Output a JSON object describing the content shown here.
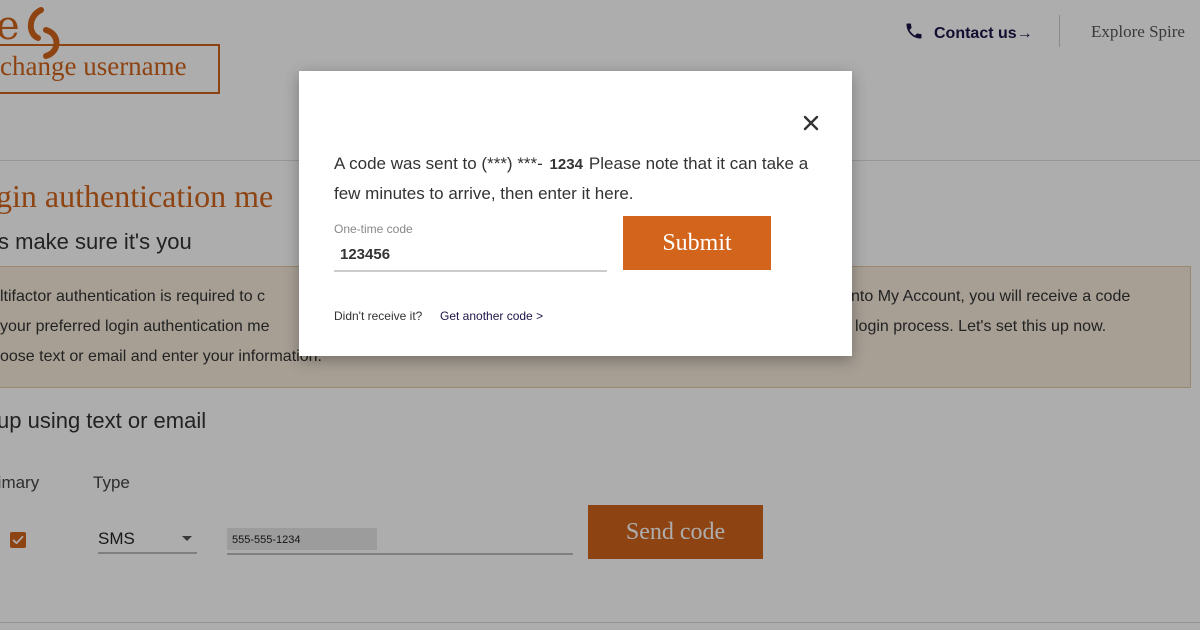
{
  "header": {
    "logo_text": "e",
    "contact_label": "Contact us",
    "contact_arrow": "→",
    "explore_label": "Explore Spire"
  },
  "page": {
    "change_username_label": "change username",
    "section_title": "gin authentication me",
    "section_subtitle": "s make sure it's you",
    "info_lines": [
      "ltifactor authentication is required to c",
      " your preferred login authentication me",
      "oose text or email and enter your information."
    ],
    "info_lines_right": [
      "nto My Account, you will receive a code",
      "login process. Let's set this up now."
    ],
    "setup_heading": "up using text or email",
    "column_primary": "rimary",
    "column_type": "Type",
    "type_selected": "SMS",
    "phone_value": "555-555-1234",
    "send_code_label": "Send code"
  },
  "modal": {
    "message_before": "A code was sent to (***) ***- ",
    "masked_digits": "1234",
    "message_after": "Please note that it can take a few minutes to arrive, then enter it here.",
    "otp_label": "One-time code",
    "otp_value": "123456",
    "submit_label": "Submit",
    "resend_text": "Didn't receive it?",
    "resend_link": "Get another code >"
  },
  "colors": {
    "brand_orange": "#d2651b",
    "brand_navy": "#1f1448",
    "info_box_bg": "#f6ebda"
  },
  "icons": {
    "logo": "spire-logo-mark",
    "phone": "phone-icon",
    "close": "close-icon",
    "check": "check-icon",
    "dropdown": "chevron-down-icon"
  }
}
